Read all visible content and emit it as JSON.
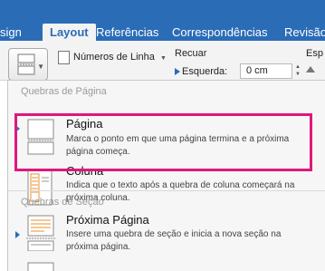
{
  "tabs": [
    {
      "label": "sign",
      "active": false
    },
    {
      "label": "Layout",
      "active": true
    },
    {
      "label": "Referências",
      "active": false
    },
    {
      "label": "Correspondências",
      "active": false
    },
    {
      "label": "Revisão",
      "active": false
    }
  ],
  "ribbon": {
    "line_numbers_label": "Números de Linha",
    "recuar_label": "Recuar",
    "esquerda_label": "Esquerda:",
    "esquerda_value": "0 cm",
    "espacamento_label": "Esp"
  },
  "menu": {
    "section_page_breaks": "Quebras de Página",
    "section_section_breaks": "Quebras de Seção",
    "items": [
      {
        "title": "Página",
        "description": "Marca o ponto em que uma página termina e a próxima página começa."
      },
      {
        "title": "Coluna",
        "description": "Indica que o texto após a quebra de coluna começará na próxima coluna."
      },
      {
        "title": "Próxima Página",
        "description": "Insere uma quebra de seção e inicia a nova seção na próxima página."
      }
    ]
  },
  "colors": {
    "ribbon_blue": "#2b6cb7",
    "highlight_magenta": "#e0177d",
    "column_break_orange": "#e8902a"
  }
}
